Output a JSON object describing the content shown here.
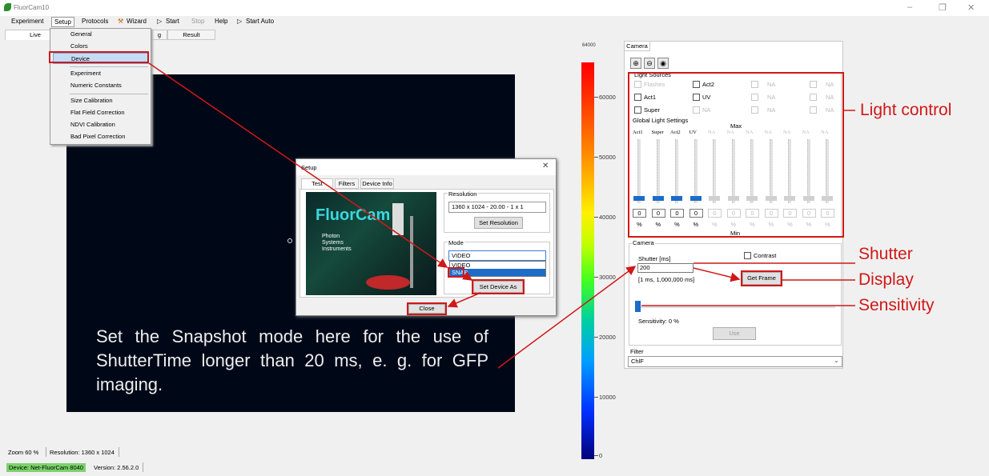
{
  "app": {
    "title": "FluorCam10"
  },
  "menu": [
    "Experiment",
    "Setup",
    "Protocols",
    "Wizard",
    "Start",
    "Stop",
    "Help",
    "Start Auto"
  ],
  "tabs": [
    "Live",
    "g",
    "Result"
  ],
  "setup_menu": {
    "items": [
      "General",
      "Colors",
      "Device",
      "Experiment",
      "Numeric Constants",
      "Size Calibration",
      "Flat Field Correction",
      "NDVI Calibration",
      "Bad Pixel Correction"
    ],
    "highlighted": "Device"
  },
  "image_text": "Set the Snapshot mode here for the use of ShutterTime longer than 20 ms, e. g. for GFP imaging.",
  "colorbar": {
    "top_label": "64000",
    "labels": [
      "60000",
      "50000",
      "40000",
      "30000",
      "20000",
      "10000",
      "0"
    ]
  },
  "dialog": {
    "title": "Setup",
    "tabs": [
      "Test Device",
      "Filters",
      "Device Info"
    ],
    "logo": {
      "brand": "FluorCam",
      "company": "Photon Systems Instruments"
    },
    "resolution_label": "Resolution",
    "resolution_value": "1360 x 1024 - 20.00 - 1 x 1",
    "set_resolution": "Set Resolution",
    "mode_label": "Mode",
    "mode_value": "VIDEO",
    "mode_options": [
      "VIDEO",
      "SNAP"
    ],
    "set_device_as": "Set Device As",
    "close": "Close"
  },
  "camera_panel": {
    "tab": "Camera",
    "light_sources": {
      "label": "Light Sources",
      "rows": [
        [
          {
            "name": "Flashes",
            "enabled": false
          },
          {
            "name": "Act2",
            "enabled": true
          },
          {
            "name": "NA",
            "enabled": false
          },
          {
            "name": "NA",
            "enabled": false
          }
        ],
        [
          {
            "name": "Act1",
            "enabled": true
          },
          {
            "name": "UV",
            "enabled": true
          },
          {
            "name": "NA",
            "enabled": false
          },
          {
            "name": "NA",
            "enabled": false
          }
        ],
        [
          {
            "name": "Super",
            "enabled": true
          },
          {
            "name": "NA",
            "enabled": false
          },
          {
            "name": "NA",
            "enabled": false
          },
          {
            "name": "NA",
            "enabled": false
          }
        ]
      ]
    },
    "global_light": {
      "label": "Global Light Settings",
      "max": "Max",
      "min": "Min",
      "channels": [
        "Act1",
        "Super",
        "Act2",
        "UV",
        "NA",
        "NA",
        "NA",
        "NA",
        "NA",
        "NA",
        "NA"
      ],
      "enabled": [
        true,
        true,
        true,
        true,
        false,
        false,
        false,
        false,
        false,
        false,
        false
      ],
      "values": [
        "0",
        "0",
        "0",
        "0",
        "0",
        "0",
        "0",
        "0",
        "0",
        "0",
        "0"
      ],
      "unit": "%"
    },
    "camera": {
      "label": "Camera",
      "shutter_label": "Shutter [ms]",
      "shutter_value": "200",
      "shutter_range": "[1 ms, 1,000,000 ms]",
      "contrast": "Contrast",
      "get_frame": "Get Frame",
      "sensitivity": "Sensitivity: 0 %",
      "sensitivity_value": 0,
      "use": "Use"
    },
    "filter": {
      "label": "Filter",
      "value": "ChlF"
    }
  },
  "annotations": {
    "light_control": "Light control",
    "shutter": "Shutter",
    "display": "Display",
    "sensitivity": "Sensitivity"
  },
  "status": {
    "zoom": "Zoom 60 %",
    "resolution": "Resolution: 1360 x 1024",
    "device": "Device: Net-FluorCam 8040",
    "version": "Version: 2.56.2.0"
  },
  "colors": {
    "annotation_red": "#d01818",
    "device_green": "#7cd36b",
    "slider_blue": "#1c6cc8"
  }
}
